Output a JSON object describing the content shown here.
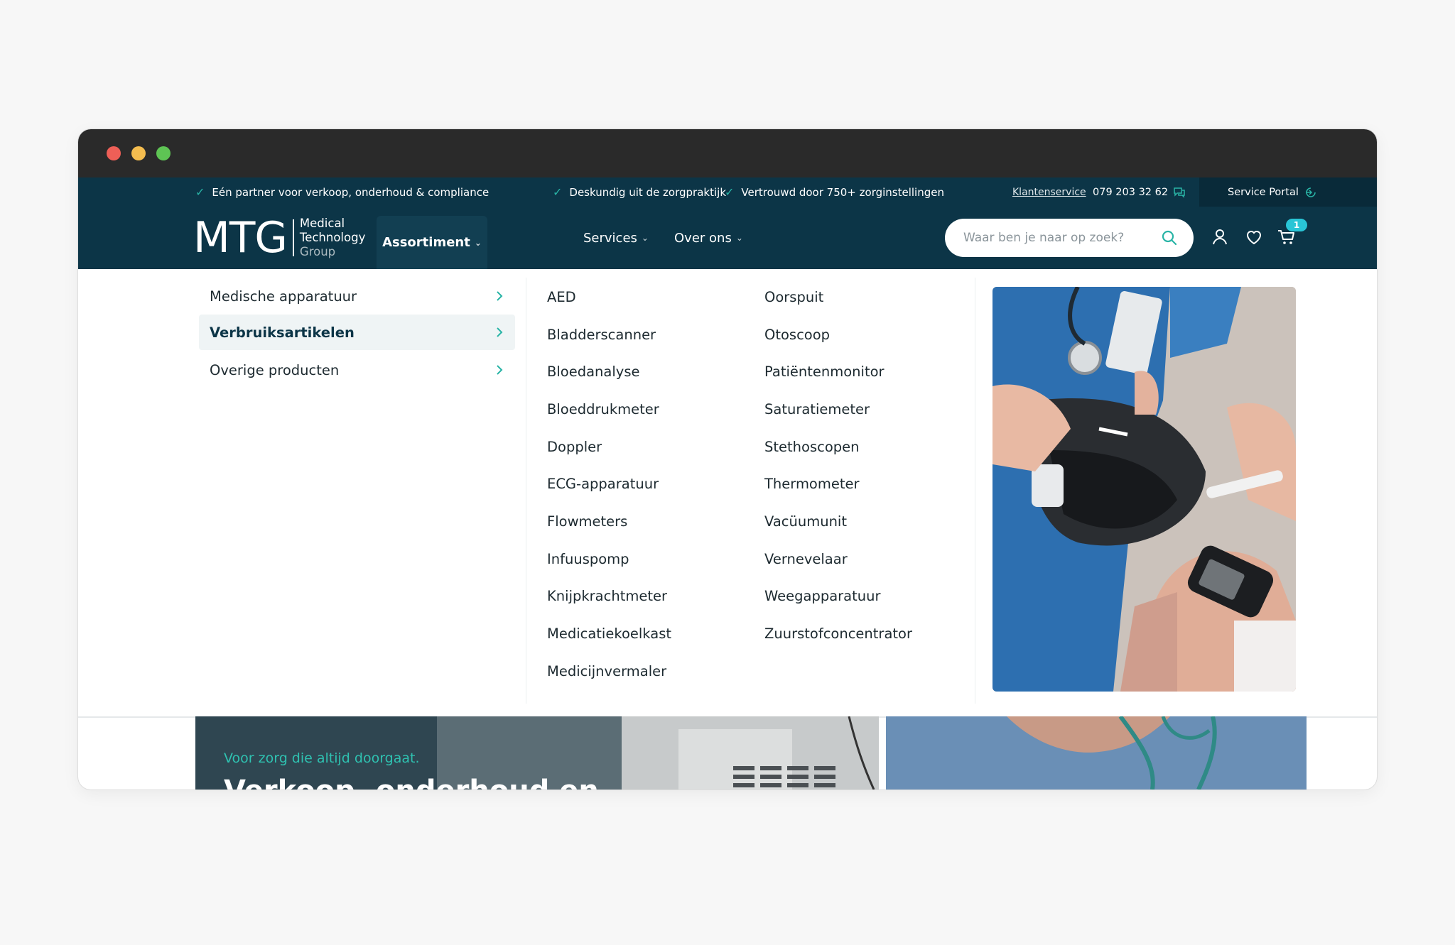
{
  "topbar": {
    "usps": [
      "Eén partner voor verkoop, onderhoud & compliance",
      "Deskundig uit de zorgpraktijk",
      "Vertrouwd door 750+ zorginstellingen"
    ],
    "klantenservice": "Klantenservice",
    "phone": "079 203 32 62",
    "service_portal": "Service Portal"
  },
  "logo": {
    "mark": "MTG",
    "line1": "Medical",
    "line2": "Technology",
    "line3": "Group"
  },
  "nav": {
    "assortiment": "Assortiment",
    "services": "Services",
    "over_ons": "Over ons"
  },
  "search": {
    "placeholder": "Waar ben je naar op zoek?"
  },
  "cart": {
    "count": "1"
  },
  "dropdown": {
    "categories": [
      "Medische apparatuur",
      "Verbruiksartikelen",
      "Overige producten"
    ],
    "active_category": "Verbruiksartikelen",
    "col1": [
      "AED",
      "Bladderscanner",
      "Bloedanalyse",
      "Bloeddrukmeter",
      "Doppler",
      "ECG-apparatuur",
      "Flowmeters",
      "Infuuspomp",
      "Knijpkrachtmeter",
      "Medicatiekoelkast",
      "Medicijnvermaler"
    ],
    "col2": [
      "Oorspuit",
      "Otoscoop",
      "Patiëntenmonitor",
      "Saturatiemeter",
      "Stethoscopen",
      "Thermometer",
      "Vacüumunit",
      "Vernevelaar",
      "Weegapparatuur",
      "Zuurstofconcentrator"
    ]
  },
  "hero": {
    "kicker": "Voor zorg die altijd doorgaat.",
    "title": "Verkoop, onderhoud en"
  },
  "colors": {
    "navy": "#0c3547",
    "teal": "#29b4a6",
    "badge": "#29c5d6"
  }
}
